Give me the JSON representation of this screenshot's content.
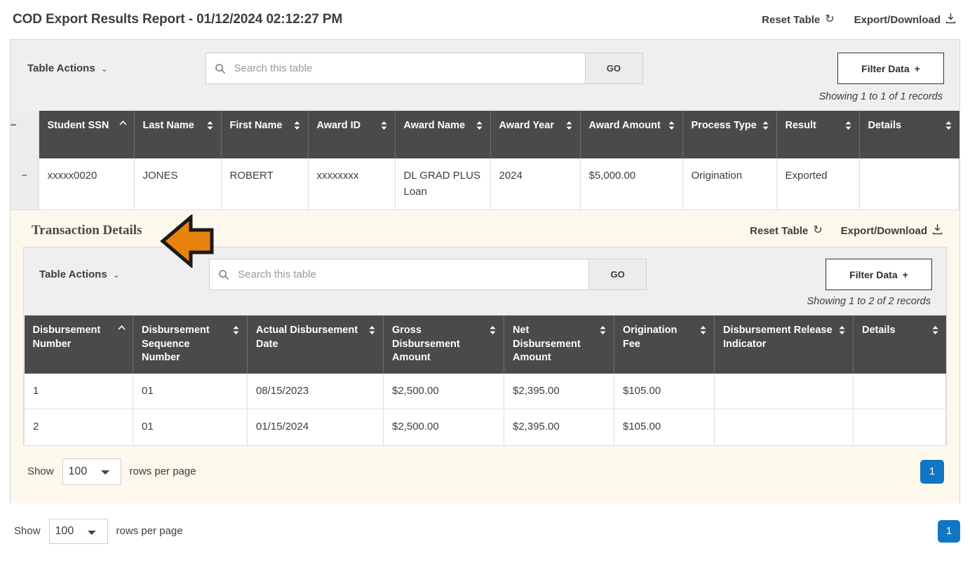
{
  "header": {
    "title": "COD Export Results Report - 01/12/2024 02:12:27 PM",
    "reset_label": "Reset Table",
    "reset_icon": "reset-circular-arrow-icon",
    "export_label": "Export/Download",
    "export_icon": "download-icon"
  },
  "outer_toolbar": {
    "table_actions_label": "Table Actions",
    "chevron_icon": "chevron-down-icon",
    "search_placeholder": "Search this table",
    "search_value": "",
    "search_icon": "search-icon",
    "go_label": "GO",
    "filter_label": "Filter Data",
    "filter_icon": "plus-icon",
    "records_text": "Showing 1 to 1 of 1 records"
  },
  "outer_table": {
    "collapse_icon": "minus-icon",
    "columns": [
      {
        "label": "Student SSN",
        "sort": "asc"
      },
      {
        "label": "Last Name",
        "sort": "none"
      },
      {
        "label": "First Name",
        "sort": "none"
      },
      {
        "label": "Award ID",
        "sort": "none"
      },
      {
        "label": "Award Name",
        "sort": "none"
      },
      {
        "label": "Award Year",
        "sort": "none"
      },
      {
        "label": "Award Amount",
        "sort": "none"
      },
      {
        "label": "Process Type",
        "sort": "none"
      },
      {
        "label": "Result",
        "sort": "none"
      },
      {
        "label": "Details",
        "sort": "none"
      }
    ],
    "rows": [
      {
        "student_ssn": "xxxxx0020",
        "last_name": "JONES",
        "first_name": "ROBERT",
        "award_id": "xxxxxxxx",
        "award_name": "DL GRAD PLUS Loan",
        "award_year": "2024",
        "award_amount": "$5,000.00",
        "process_type": "Origination",
        "result": "Exported",
        "details": ""
      }
    ]
  },
  "nested": {
    "title": "Transaction Details",
    "reset_label": "Reset Table",
    "export_label": "Export/Download",
    "toolbar": {
      "table_actions_label": "Table Actions",
      "search_placeholder": "Search this table",
      "search_value": "",
      "go_label": "GO",
      "filter_label": "Filter Data",
      "records_text": "Showing 1 to 2 of 2 records"
    },
    "table": {
      "columns": [
        {
          "label": "Disbursement Number",
          "sort": "asc"
        },
        {
          "label": "Disbursement Sequence Number",
          "sort": "none"
        },
        {
          "label": "Actual Disbursement Date",
          "sort": "none"
        },
        {
          "label": "Gross Disbursement Amount",
          "sort": "none"
        },
        {
          "label": "Net Disbursement Amount",
          "sort": "none"
        },
        {
          "label": "Origination Fee",
          "sort": "none"
        },
        {
          "label": "Disbursement Release Indicator",
          "sort": "none"
        },
        {
          "label": "Details",
          "sort": "none"
        }
      ],
      "rows": [
        {
          "disbursement_number": "1",
          "disbursement_sequence_number": "01",
          "actual_disbursement_date": "08/15/2023",
          "gross_disbursement_amount": "$2,500.00",
          "net_disbursement_amount": "$2,395.00",
          "origination_fee": "$105.00",
          "disbursement_release_indicator": "",
          "details": ""
        },
        {
          "disbursement_number": "2",
          "disbursement_sequence_number": "01",
          "actual_disbursement_date": "01/15/2024",
          "gross_disbursement_amount": "$2,500.00",
          "net_disbursement_amount": "$2,395.00",
          "origination_fee": "$105.00",
          "disbursement_release_indicator": "",
          "details": ""
        }
      ]
    },
    "footer": {
      "show_label": "Show",
      "rows_value": "100",
      "rows_options": [
        "100"
      ],
      "rows_suffix": "rows per page",
      "page_number": "1"
    }
  },
  "outer_footer": {
    "show_label": "Show",
    "rows_value": "100",
    "rows_options": [
      "100"
    ],
    "rows_suffix": "rows per page",
    "page_number": "1"
  },
  "annotation": {
    "arrow_icon": "left-arrow-annotation",
    "arrow_color": "#E8820C",
    "arrow_outline": "#1a1a1a"
  },
  "colors": {
    "header_dark": "#4a4a4a",
    "panel_cream": "#fdf8ec",
    "toolbar_gray": "#efefef",
    "page_badge_blue": "#1177c4"
  }
}
